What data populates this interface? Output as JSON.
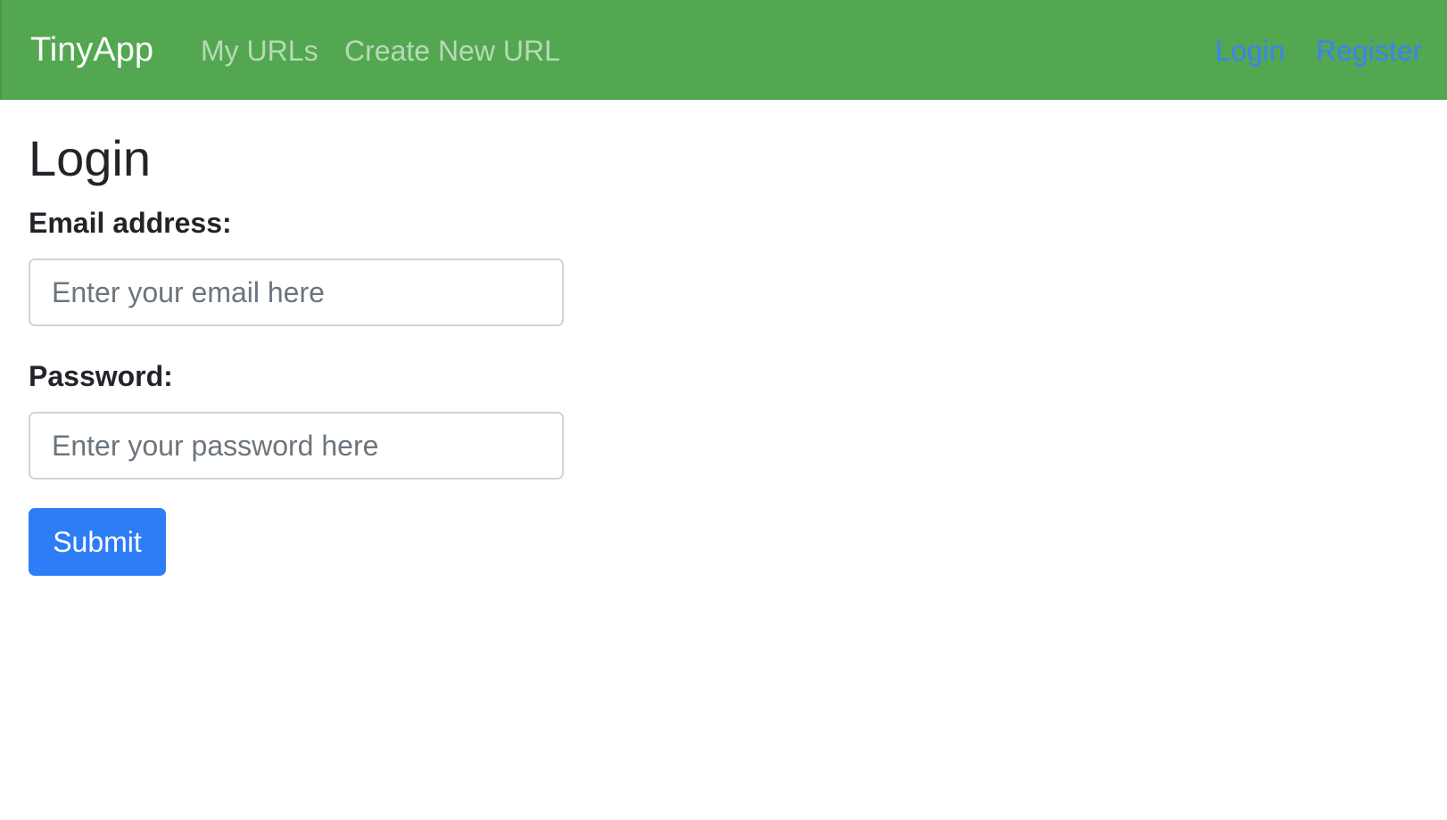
{
  "navbar": {
    "brand": "TinyApp",
    "left_links": [
      "My URLs",
      "Create New URL"
    ],
    "right_links": [
      "Login",
      "Register"
    ],
    "background_color": "#53a751",
    "active_link_color": "#3b82f6"
  },
  "page": {
    "title": "Login"
  },
  "form": {
    "email_label": "Email address:",
    "email_placeholder": "Enter your email here",
    "email_value": "",
    "password_label": "Password:",
    "password_placeholder": "Enter your password here",
    "password_value": "",
    "submit_label": "Submit",
    "submit_color": "#2f7df6"
  }
}
